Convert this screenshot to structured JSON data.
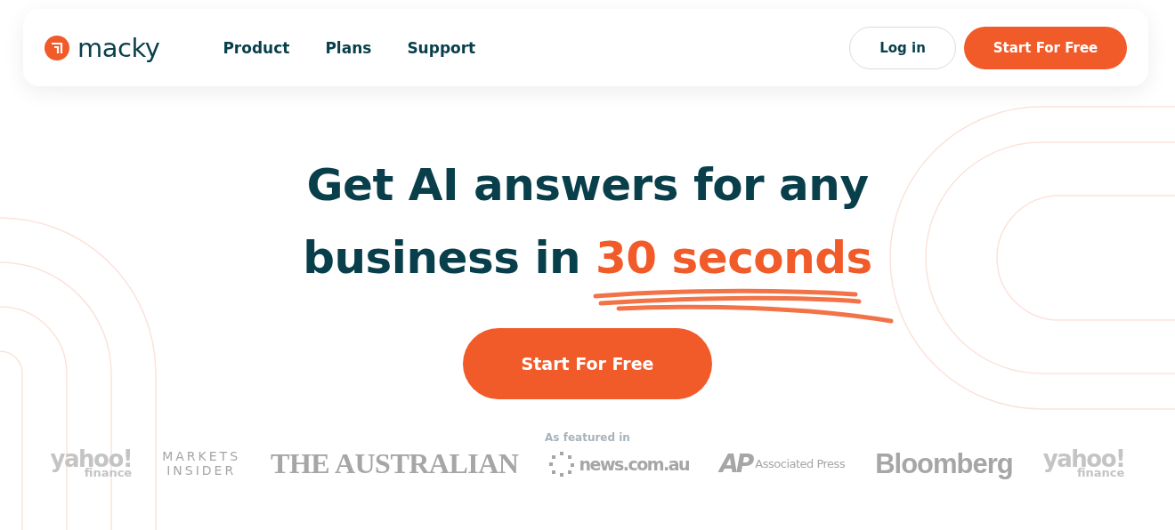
{
  "nav": {
    "brand": "macky",
    "links": [
      {
        "label": "Product"
      },
      {
        "label": "Plans"
      },
      {
        "label": "Support"
      }
    ],
    "buttons": [
      {
        "label": "Log in",
        "kind": "outline"
      },
      {
        "label": "Start For Free",
        "kind": "primary"
      }
    ]
  },
  "hero": {
    "headline": "Get AI answers for any business in",
    "highlight": "30 seconds",
    "cta": "Start For Free"
  },
  "featured": {
    "label": "As featured in",
    "logos": [
      {
        "kind": "yahoo",
        "text": "yahoo!",
        "sub": "finance",
        "faded": true
      },
      {
        "kind": "markets",
        "text": "MARKETS",
        "sub": "INSIDER",
        "faded": false
      },
      {
        "kind": "australian",
        "text": "THE AUSTRALIAN",
        "faded": false
      },
      {
        "kind": "news",
        "text": "news.com.au",
        "faded": false
      },
      {
        "kind": "ap",
        "text": "AP",
        "sub": "Associated Press",
        "faded": false
      },
      {
        "kind": "bloomberg",
        "text": "Bloomberg",
        "faded": false
      },
      {
        "kind": "yahoo",
        "text": "yahoo!",
        "sub": "finance",
        "faded": true
      }
    ]
  }
}
